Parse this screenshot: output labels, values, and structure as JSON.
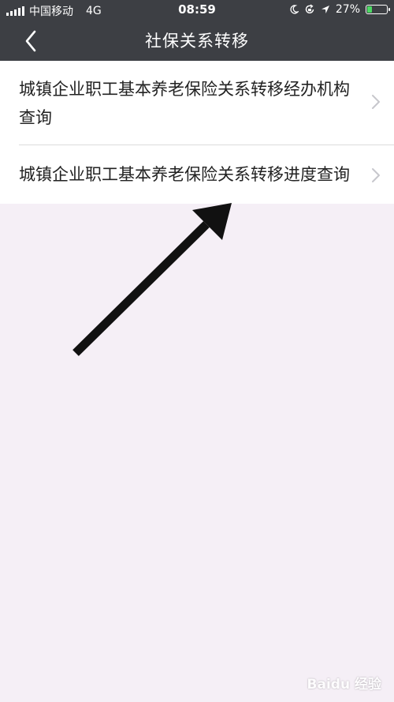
{
  "status_bar": {
    "carrier": "中国移动",
    "network": "4G",
    "time": "08:59",
    "battery_percent": "27%",
    "battery_level": 0.27,
    "icons": [
      "moon-icon",
      "rotation-lock-icon",
      "location-icon"
    ]
  },
  "nav": {
    "title": "社保关系转移",
    "back_icon": "chevron-left-icon"
  },
  "menu": {
    "items": [
      {
        "label": "城镇企业职工基本养老保险关系转移经办机构查询"
      },
      {
        "label": "城镇企业职工基本养老保险关系转移进度查询"
      }
    ]
  },
  "watermark": {
    "text": "Baidu 经验"
  },
  "colors": {
    "header_bg": "#3d3f44",
    "page_bg": "#f5eff6",
    "list_bg": "#ffffff",
    "text": "#222222",
    "chevron": "#c7c7cc",
    "battery_fill": "#4cd964"
  }
}
